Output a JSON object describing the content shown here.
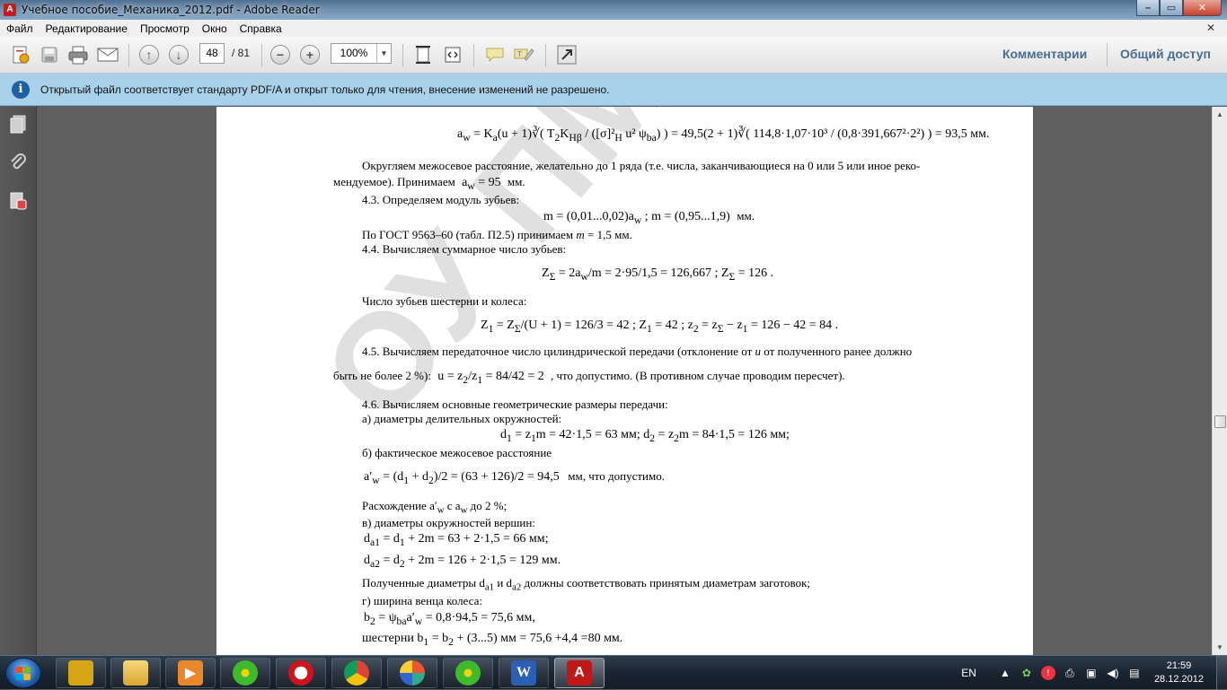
{
  "window": {
    "title": "Учебное пособие_Механика_2012.pdf - Adobe Reader",
    "controls": [
      "–",
      "▭",
      "✕"
    ]
  },
  "menu": {
    "items": [
      "Файл",
      "Редактирование",
      "Просмотр",
      "Окно",
      "Справка"
    ],
    "close_doc": "✕"
  },
  "toolbar": {
    "page_current": "48",
    "page_total": "/ 81",
    "zoom": "100%",
    "comments_label": "Комментарии",
    "share_label": "Общий доступ"
  },
  "infobar": {
    "icon": "i",
    "message": "Открытый файл соответствует стандарту PDF/A и открыт только для чтения, внесение изменений не разрешено."
  },
  "nav_icons": [
    "pages-icon",
    "attachments-icon",
    "signatures-icon"
  ],
  "document": {
    "watermark": "ОУ ПМ и СМ",
    "formula_aw": "a<sub>w</sub> = K<sub>a</sub>(u + 1)∛( T<sub>2</sub>K<sub>Hβ</sub> / ([σ]²<sub>H</sub> u² ψ<sub>ba</sub>) ) = 49,5(2 + 1)∛( 114,8·1,07·10³ / (0,8·391,667²·2²) ) = 93,5 мм.",
    "p_round_1": "Округляем межосевое расстояние, желательно до 1 ряда (т.е. числа, заканчивающиеся на 0 или 5 или иное реко-",
    "p_round_2a": "мендуемое). Принимаем",
    "p_round_2b": "a<sub>w</sub> = 95",
    "p_round_2c": "мм.",
    "s43": "4.3. Определяем модуль зубьев:",
    "formula_m": "m = (0,01...0,02)a<sub>w</sub> ;  m = (0,95...1,9)",
    "formula_m_unit": "мм.",
    "p_gost": "По ГОСТ 9563–60 (табл. П2.5) принимаем <i>m</i> = 1,5 мм.",
    "s44": "4.4. Вычисляем суммарное число зубьев:",
    "formula_zsum": "Z<sub>Σ</sub> = 2a<sub>w</sub>/m = 2·95/1,5 = 126,667 ;  Z<sub>Σ</sub> = 126 .",
    "p_z12": "Число зубьев шестерни и колеса:",
    "formula_z1": "Z<sub>1</sub> = Z<sub>Σ</sub>/(U + 1) = 126/3 = 42 ;  Z<sub>1</sub> = 42 ;  z<sub>2</sub> = z<sub>Σ</sub> − z<sub>1</sub> = 126 − 42 = 84 .",
    "s45_1": "4.5. Вычисляем передаточное число цилиндрической передачи (отклонение от <i>u</i> от полученного ранее должно",
    "s45_2a": "быть не более 2 %):",
    "s45_2b": "u = z<sub>2</sub>/z<sub>1</sub> = 84/42 = 2",
    "s45_2c": ", что допустимо. (В противном случае проводим пересчет).",
    "s46": "4.6. Вычисляем основные геометрические размеры передачи:",
    "s46a": "а) диаметры делительных окружностей:",
    "formula_d": "d<sub>1</sub> = z<sub>1</sub>m = 42·1,5 = 63  мм;  d<sub>2</sub> = z<sub>2</sub>m = 84·1,5 = 126  мм;",
    "s46b": "б) фактическое межосевое расстояние",
    "formula_aw2": "a′<sub>w</sub> = (d<sub>1</sub> + d<sub>2</sub>)/2 = (63 + 126)/2 = 94,5",
    "formula_aw2_tail": "мм, что допустимо.",
    "p_diff": "Расхождение  a′<sub>w</sub>  с  a<sub>w</sub>  до 2 %;",
    "s46v": "в) диаметры окружностей вершин:",
    "formula_da1": "d<sub>a1</sub> = d<sub>1</sub> + 2m = 63 + 2·1,5 = 66  мм;",
    "formula_da2": "d<sub>a2</sub> = d<sub>2</sub> + 2m = 126 + 2·1,5 = 129  мм.",
    "p_da": "Полученные диаметры  d<sub>a1</sub>  и  d<sub>a2</sub>  должны соответствовать принятым диаметрам заготовок;",
    "s46g": "г) ширина венца колеса:",
    "formula_b2": "b<sub>2</sub> = ψ<sub>ba</sub>a′<sub>w</sub> = 0,8·94,5 = 75,6  мм,",
    "formula_b1": "шестерни  b<sub>1</sub> = b<sub>2</sub> + (3...5) мм = 75,6 +4,4 =80 мм."
  },
  "taskbar": {
    "language": "EN",
    "time": "21:59",
    "date": "28.12.2012"
  }
}
